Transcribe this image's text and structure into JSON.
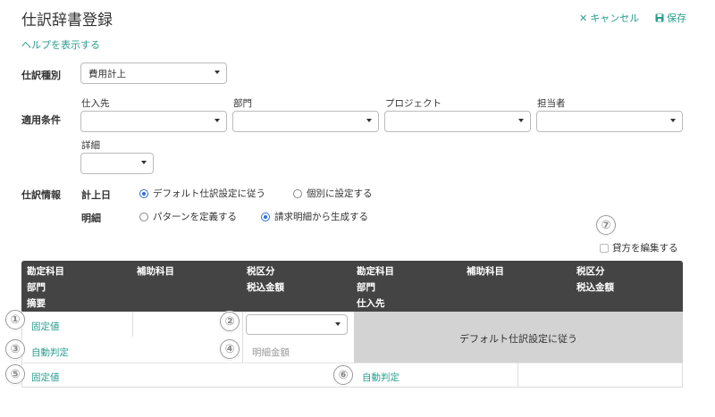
{
  "header": {
    "title": "仕訳辞書登録",
    "cancel_label": "キャンセル",
    "save_label": "保存",
    "help_link": "ヘルプを表示する"
  },
  "form": {
    "journal_type": {
      "label": "仕訳種別",
      "value": "費用計上"
    },
    "conditions": {
      "label": "適用条件",
      "fields": [
        {
          "label": "仕入先",
          "value": ""
        },
        {
          "label": "部門",
          "value": ""
        },
        {
          "label": "プロジェクト",
          "value": ""
        },
        {
          "label": "担当者",
          "value": ""
        },
        {
          "label": "詳細",
          "value": ""
        }
      ]
    },
    "journal_info": {
      "label": "仕訳情報",
      "posting_date": {
        "label": "計上日",
        "options": [
          "デフォルト仕訳設定に従う",
          "個別に設定する"
        ],
        "selected": 0
      },
      "details": {
        "label": "明細",
        "options": [
          "パターンを定義する",
          "請求明細から生成する"
        ],
        "selected": 1
      }
    },
    "edit_credit_label": "貸方を編集する"
  },
  "table": {
    "debit_headers": {
      "account": "勘定科目",
      "sub_account": "補助科目",
      "tax": "税区分",
      "department": "部門",
      "tax_included": "税込金額",
      "memo": "摘要"
    },
    "credit_headers": {
      "account": "勘定科目",
      "sub_account": "補助科目",
      "tax": "税区分",
      "department": "部門",
      "tax_included": "税込金額",
      "supplier": "仕入先"
    },
    "rows": {
      "debit_account": "固定値",
      "debit_department": "自動判定",
      "debit_amount_placeholder": "明細金額",
      "debit_memo": "固定値",
      "credit_default": "デフォルト仕訳設定に従う",
      "credit_supplier": "自動判定"
    }
  },
  "badges": [
    "①",
    "②",
    "③",
    "④",
    "⑤",
    "⑥",
    "⑦"
  ],
  "colors": {
    "accent": "#2a9d8f",
    "header_bg": "#444444",
    "disabled_bg": "#d3d3d3",
    "radio": "#2b6fd6"
  }
}
